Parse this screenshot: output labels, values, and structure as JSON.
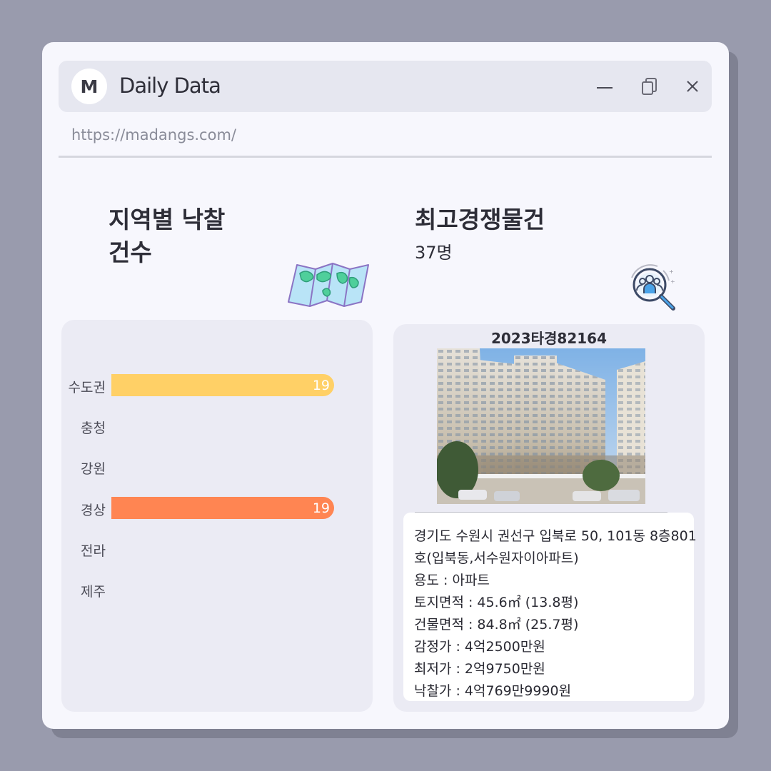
{
  "window": {
    "logo_letter": "M",
    "title": "Daily Data",
    "url": "https://madangs.com/"
  },
  "left_card": {
    "heading_line1": "지역별 낙찰",
    "heading_line2": "건수",
    "icon": "folded-map-icon"
  },
  "right_card": {
    "heading": "최고경쟁물건",
    "competitors": "37명",
    "icon": "magnifier-people-icon"
  },
  "chart_data": {
    "type": "bar",
    "orientation": "horizontal",
    "categories": [
      "수도권",
      "충청",
      "강원",
      "경상",
      "전라",
      "제주"
    ],
    "values": [
      19,
      0,
      0,
      19,
      0,
      0
    ],
    "colors": [
      "#ffd066",
      "#ffd066",
      "#ffd066",
      "#ff8552",
      "#ff8552",
      "#ff8552"
    ],
    "data_labels": [
      "19",
      "",
      "",
      "19",
      "",
      ""
    ],
    "xlim": [
      0,
      19
    ]
  },
  "property": {
    "case_number": "2023타경82164",
    "photo": "apartment-building-photo",
    "address_line1": "경기도 수원시 권선구 입북로 50, 101동 8층801",
    "address_line2": "호(입북동,서수원자이아파트)",
    "usage": "용도 : 아파트",
    "land_area": "토지면적 : 45.6㎡ (13.8평)",
    "building_area": "건물면적 : 84.8㎡ (25.7평)",
    "appraisal": "감정가 : 4억2500만원",
    "minimum_price": "최저가 : 2억9750만원",
    "winning_bid": "낙찰가 : 4억769만9990원"
  }
}
